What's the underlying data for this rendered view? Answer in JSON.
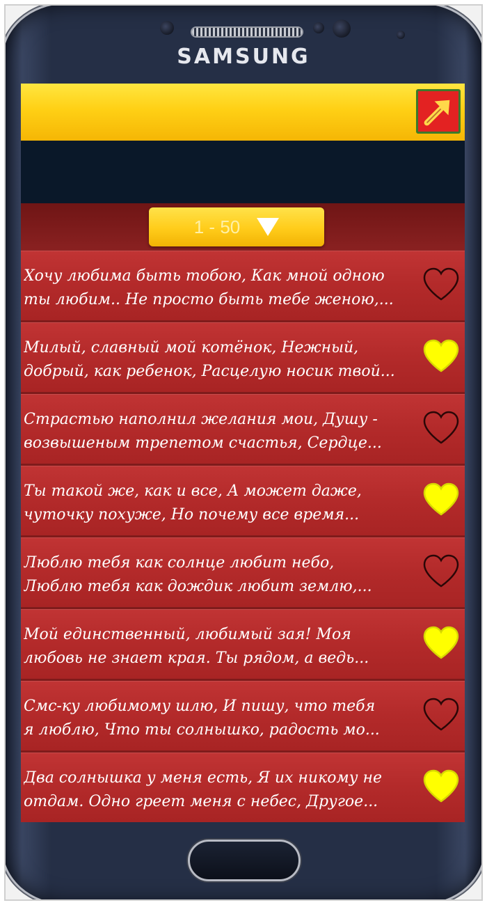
{
  "device": {
    "brand": "SAMSUNG"
  },
  "colors": {
    "accent": "#ffd015",
    "list_bg": "#b32a2a",
    "fav_heart": "#ffff00",
    "share_bg": "#e32222"
  },
  "toolbar": {
    "share_icon": "share-arrow-icon"
  },
  "range_picker": {
    "label": "1 - 50",
    "icon": "dropdown-arrow-icon"
  },
  "messages": [
    {
      "text": "Хочу любима быть тобою, Как мной одною\nты любим.. Не просто быть тебе женою,...",
      "favorite": false
    },
    {
      "text": "Милый, славный мой котёнок, Нежный,\nдобрый, как ребенок, Расцелую носик твой...",
      "favorite": true
    },
    {
      "text": "Страстью наполнил желания мои, Душу -\nвозвышеным трепетом счастья, Сердце...",
      "favorite": false
    },
    {
      "text": "Ты такой же, как и все, А может даже,\nчуточку похуже, Но почему все время...",
      "favorite": true
    },
    {
      "text": "Люблю тебя как солнце любит небо,\nЛюблю тебя как дождик любит землю,...",
      "favorite": false
    },
    {
      "text": "Мой единственный, любимый зая! Моя\nлюбовь не знает края. Ты рядом, а ведь...",
      "favorite": true
    },
    {
      "text": "Смс-ку любимому шлю, И пишу, что тебя\nя люблю, Что ты солнышко, радость мо...",
      "favorite": false
    },
    {
      "text": "Два солнышка у меня есть, Я их никому не\nотдам. Одно греет меня с небес, Другое...",
      "favorite": true
    }
  ]
}
